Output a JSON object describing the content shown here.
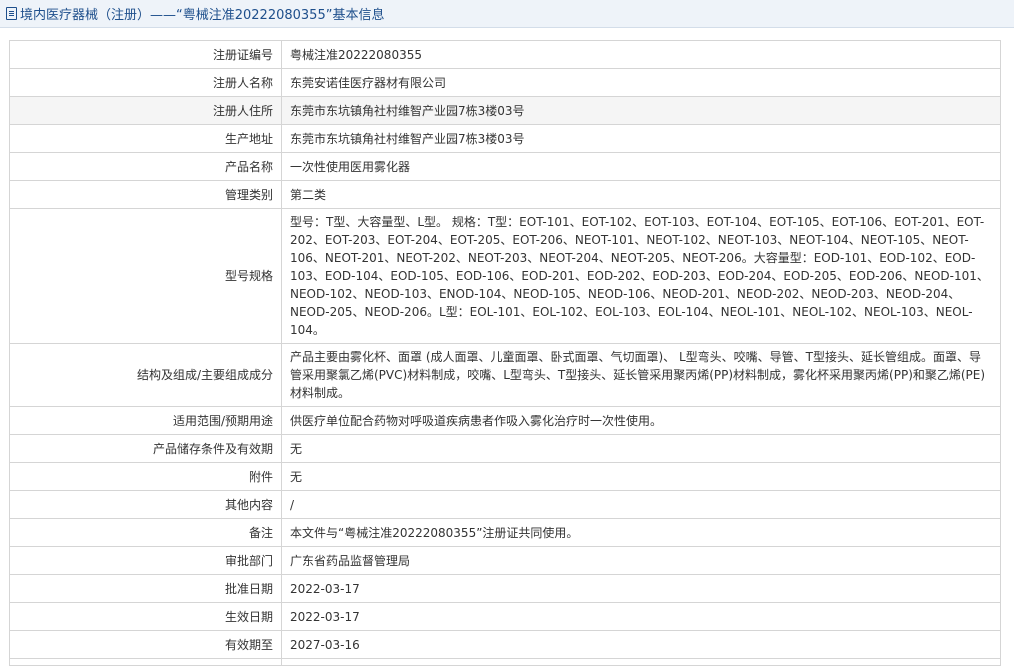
{
  "header": {
    "title": "境内医疗器械（注册）——“粤械注准20222080355”基本信息"
  },
  "fields": [
    {
      "label": "注册证编号",
      "value": "粤械注准20222080355"
    },
    {
      "label": "注册人名称",
      "value": "东莞安诺佳医疗器材有限公司"
    },
    {
      "label": "注册人住所",
      "value": "东莞市东坑镇角社村维智产业园7栋3楼03号"
    },
    {
      "label": "生产地址",
      "value": "东莞市东坑镇角社村维智产业园7栋3楼03号"
    },
    {
      "label": "产品名称",
      "value": "一次性使用医用雾化器"
    },
    {
      "label": "管理类别",
      "value": "第二类"
    },
    {
      "label": "型号规格",
      "value": "型号：T型、大容量型、L型。 规格：T型：EOT-101、EOT-102、EOT-103、EOT-104、EOT-105、EOT-106、EOT-201、EOT-202、EOT-203、EOT-204、EOT-205、EOT-206、NEOT-101、NEOT-102、NEOT-103、NEOT-104、NEOT-105、NEOT-106、NEOT-201、NEOT-202、NEOT-203、NEOT-204、NEOT-205、NEOT-206。大容量型：EOD-101、EOD-102、EOD-103、EOD-104、EOD-105、EOD-106、EOD-201、EOD-202、EOD-203、EOD-204、EOD-205、EOD-206、NEOD-101、NEOD-102、NEOD-103、ENOD-104、NEOD-105、NEOD-106、NEOD-201、NEOD-202、NEOD-203、NEOD-204、NEOD-205、NEOD-206。L型：EOL-101、EOL-102、EOL-103、EOL-104、NEOL-101、NEOL-102、NEOL-103、NEOL-104。"
    },
    {
      "label": "结构及组成/主要组成成分",
      "value": "产品主要由雾化杯、面罩 (成人面罩、儿童面罩、卧式面罩、气切面罩)、 L型弯头、咬嘴、导管、T型接头、延长管组成。面罩、导管采用聚氯乙烯(PVC)材料制成，咬嘴、L型弯头、T型接头、延长管采用聚丙烯(PP)材料制成，雾化杯采用聚丙烯(PP)和聚乙烯(PE)材料制成。"
    },
    {
      "label": "适用范围/预期用途",
      "value": "供医疗单位配合药物对呼吸道疾病患者作吸入雾化治疗时一次性使用。"
    },
    {
      "label": "产品储存条件及有效期",
      "value": "无"
    },
    {
      "label": "附件",
      "value": "无"
    },
    {
      "label": "其他内容",
      "value": "/"
    },
    {
      "label": "备注",
      "value": "本文件与“粤械注准20222080355”注册证共同使用。"
    },
    {
      "label": "审批部门",
      "value": "广东省药品监督管理局"
    },
    {
      "label": "批准日期",
      "value": "2022-03-17"
    },
    {
      "label": "生效日期",
      "value": "2022-03-17"
    },
    {
      "label": "有效期至",
      "value": "2027-03-16"
    }
  ]
}
